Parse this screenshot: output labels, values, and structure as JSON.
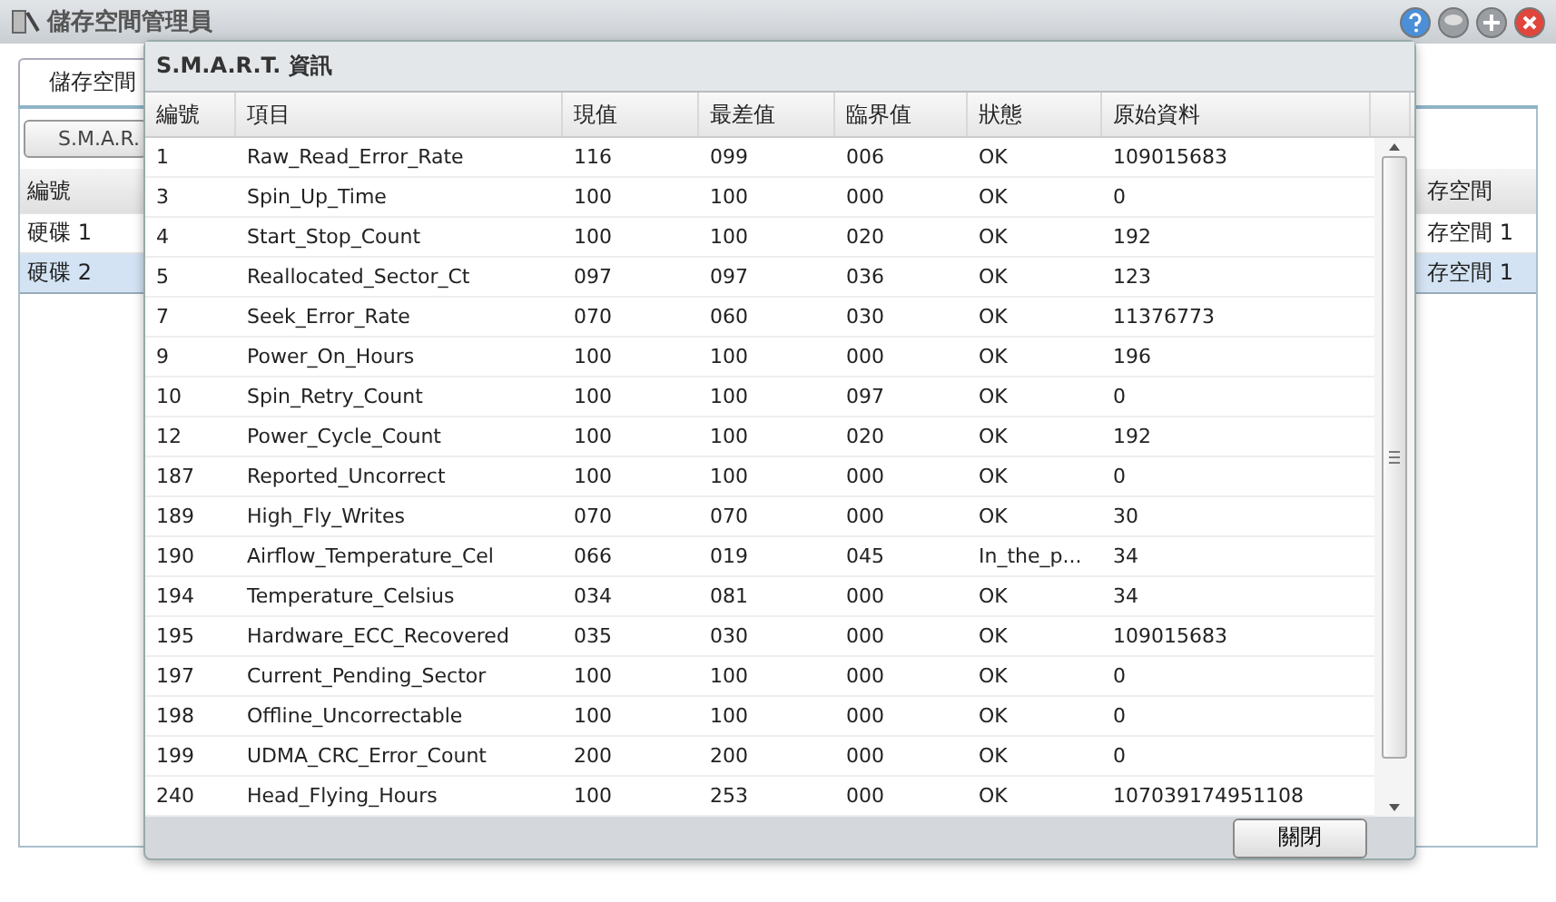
{
  "window": {
    "title": "儲存空間管理員"
  },
  "tabs": [
    {
      "label": "儲存空間",
      "selected": true
    }
  ],
  "toolbar": {
    "button": "S.M.A.R."
  },
  "disk_grid": {
    "columns": [
      "編號",
      "存空間"
    ],
    "rows": [
      {
        "cells": [
          "硬碟 1",
          "存空間 1"
        ],
        "selected": false
      },
      {
        "cells": [
          "硬碟 2",
          "存空間 1"
        ],
        "selected": true
      }
    ]
  },
  "dialog": {
    "title": "S.M.A.R.T. 資訊",
    "columns": [
      "編號",
      "項目",
      "現值",
      "最差值",
      "臨界值",
      "狀態",
      "原始資料"
    ],
    "rows": [
      [
        "1",
        "Raw_Read_Error_Rate",
        "116",
        "099",
        "006",
        "OK",
        "109015683"
      ],
      [
        "3",
        "Spin_Up_Time",
        "100",
        "100",
        "000",
        "OK",
        "0"
      ],
      [
        "4",
        "Start_Stop_Count",
        "100",
        "100",
        "020",
        "OK",
        "192"
      ],
      [
        "5",
        "Reallocated_Sector_Ct",
        "097",
        "097",
        "036",
        "OK",
        "123"
      ],
      [
        "7",
        "Seek_Error_Rate",
        "070",
        "060",
        "030",
        "OK",
        "11376773"
      ],
      [
        "9",
        "Power_On_Hours",
        "100",
        "100",
        "000",
        "OK",
        "196"
      ],
      [
        "10",
        "Spin_Retry_Count",
        "100",
        "100",
        "097",
        "OK",
        "0"
      ],
      [
        "12",
        "Power_Cycle_Count",
        "100",
        "100",
        "020",
        "OK",
        "192"
      ],
      [
        "187",
        "Reported_Uncorrect",
        "100",
        "100",
        "000",
        "OK",
        "0"
      ],
      [
        "189",
        "High_Fly_Writes",
        "070",
        "070",
        "000",
        "OK",
        "30"
      ],
      [
        "190",
        "Airflow_Temperature_Cel",
        "066",
        "019",
        "045",
        "In_the_p...",
        "34"
      ],
      [
        "194",
        "Temperature_Celsius",
        "034",
        "081",
        "000",
        "OK",
        "34"
      ],
      [
        "195",
        "Hardware_ECC_Recovered",
        "035",
        "030",
        "000",
        "OK",
        "109015683"
      ],
      [
        "197",
        "Current_Pending_Sector",
        "100",
        "100",
        "000",
        "OK",
        "0"
      ],
      [
        "198",
        "Offline_Uncorrectable",
        "100",
        "100",
        "000",
        "OK",
        "0"
      ],
      [
        "199",
        "UDMA_CRC_Error_Count",
        "200",
        "200",
        "000",
        "OK",
        "0"
      ],
      [
        "240",
        "Head_Flying_Hours",
        "100",
        "253",
        "000",
        "OK",
        "107039174951108"
      ]
    ],
    "close_button": "關閉"
  }
}
